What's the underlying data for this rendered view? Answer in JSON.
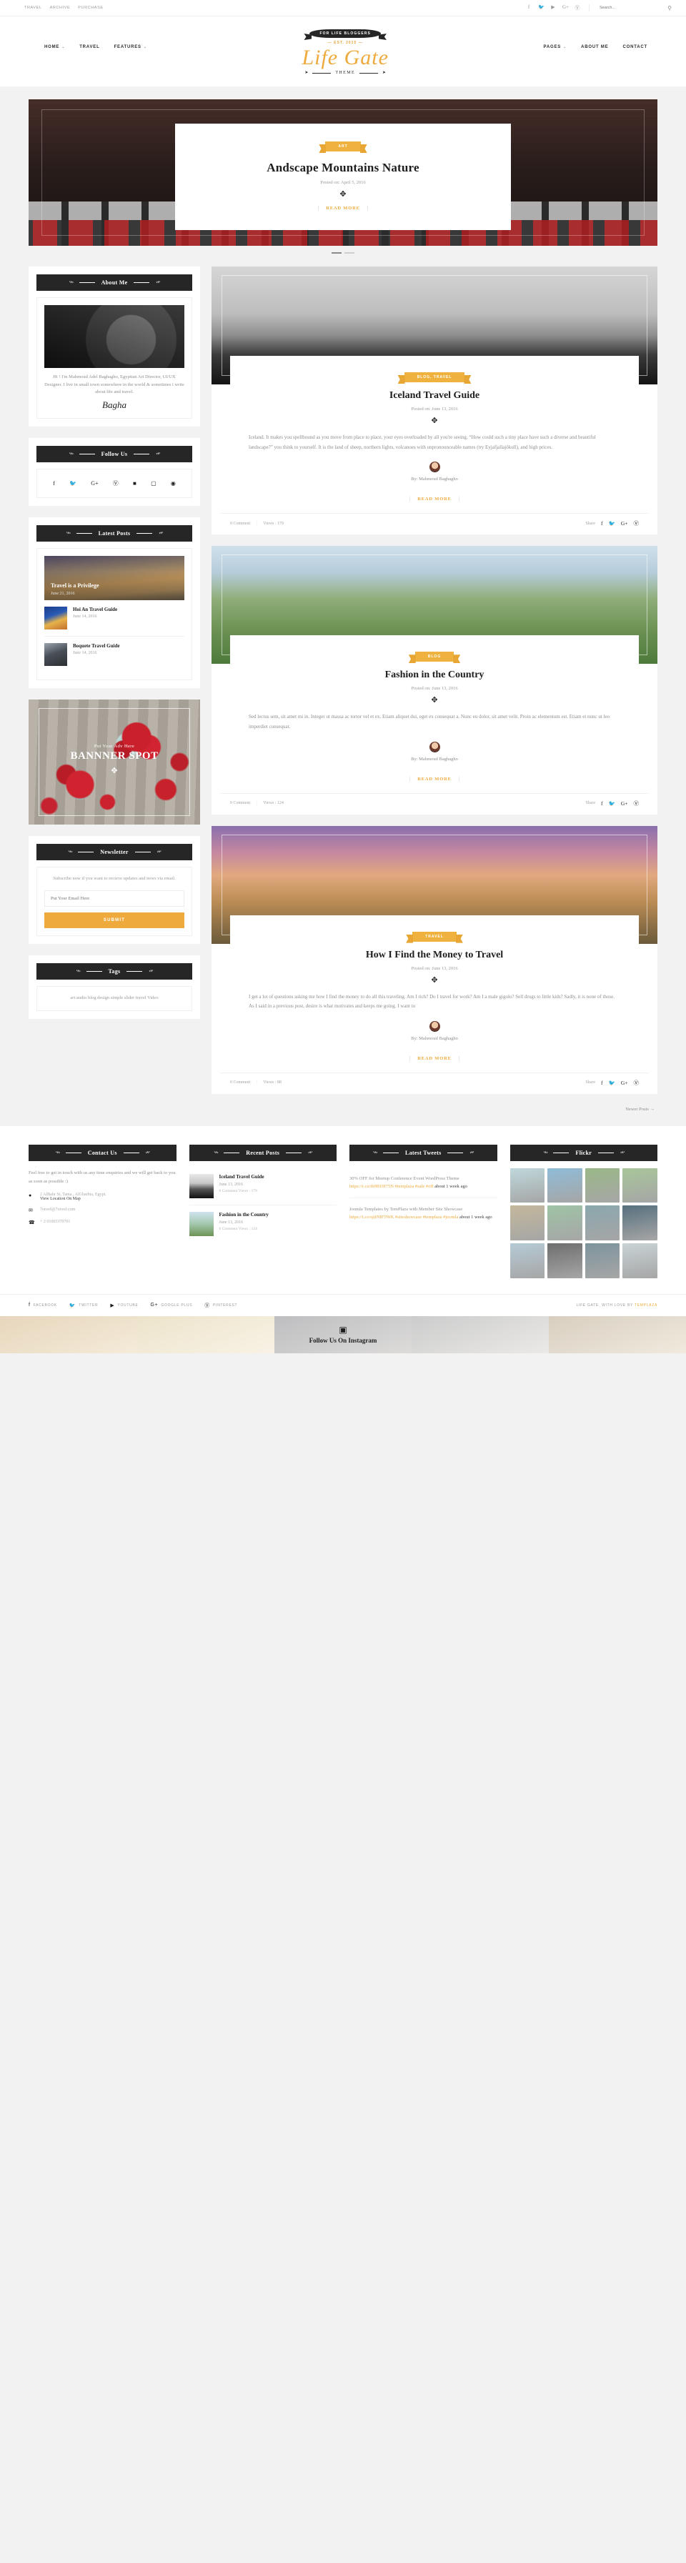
{
  "topbar": {
    "links": [
      "TRAVEL",
      "ARCHIVE",
      "PURCHASE"
    ],
    "social": [
      "facebook-icon",
      "twitter-icon",
      "youtube-icon",
      "google-plus-icon",
      "pinterest-icon"
    ],
    "search_placeholder": "Search...",
    "search_value": ""
  },
  "header": {
    "nav_left": [
      {
        "label": "HOME",
        "caret": "˅"
      },
      {
        "label": "TRAVEL",
        "caret": ""
      },
      {
        "label": "FEATURES",
        "caret": "˅"
      }
    ],
    "nav_right": [
      {
        "label": "PAGES",
        "caret": "˅"
      },
      {
        "label": "ABOUT ME",
        "caret": ""
      },
      {
        "label": "CONTACT",
        "caret": ""
      }
    ],
    "ribbon": "FOR LIFE BLOGGERS",
    "est": "EST. 2015",
    "logo": "Life Gate",
    "theme": "THEME"
  },
  "slider": {
    "category": "ART",
    "title": "Andscape Mountains Nature",
    "posted_label": "Posted on:",
    "date": "April 5, 2016",
    "read_more": "READ MORE",
    "dots": 2,
    "active_dot": 0
  },
  "sidebar": {
    "about": {
      "title": "About Me",
      "bio": "Hi ! I'm Mahmoud Adel Baghagho, Egyptian Art Director, UI/UX Designer. I live in small town somewhere in the world & sometimes i write about life and travel.",
      "signature": "Bagha"
    },
    "follow": {
      "title": "Follow Us",
      "icons": [
        "facebook-icon",
        "twitter-icon",
        "google-plus-icon",
        "pinterest-icon",
        "vimeo-icon",
        "instagram-icon",
        "rss-icon"
      ]
    },
    "latest": {
      "title": "Latest Posts",
      "featured": {
        "title": "Travel is a Privilege",
        "date": "June 21, 2016"
      },
      "items": [
        {
          "title": "Hoi An Travel Guide",
          "date": "June 14, 2016"
        },
        {
          "title": "Boquete Travel Guide",
          "date": "June 14, 2016"
        }
      ]
    },
    "banner": {
      "small": "Put Your Adv Here",
      "big": "BANNNER SPOT"
    },
    "newsletter": {
      "title": "Newsletter",
      "text": "Subscribe now if you want to recieve updates and news via email.",
      "placeholder": "Put Your Email Here",
      "value": "",
      "submit": "SUBMIT"
    },
    "tags": {
      "title": "Tags",
      "items": "art audio blog design simple slider travel Video"
    }
  },
  "posts": [
    {
      "category": "BLOG, TRAVEL",
      "title": "Iceland Travel Guide",
      "posted_label": "Posted on:",
      "date": "June 13, 2016",
      "excerpt": "Iceland. It makes you spellbound as you move from place to place, your eyes overloaded by all you're seeing. “How could such a tiny place have such a diverse and beautiful landscape?” you think to yourself. It is the land of sheep, northern lights, volcanoes with unpronounceable names (try Eyjafjallajökull), and high prices.",
      "by": "By: Mahmoud Baghagho",
      "read_more": "READ MORE",
      "comments": "0  Comment",
      "views": "Views : 179",
      "share_label": "Share"
    },
    {
      "category": "BLOG",
      "title": "Fashion in the Country",
      "posted_label": "Posted on:",
      "date": "June 13, 2016",
      "excerpt": "Sed lectus sem, sit amet mi in. Integer ut massa ac tortor vel et ex. Etiam aliquet dui, eget ex consequat a. Nunc eu dolor, sit amet velit. Proin ac elementum est. Etiam et nunc ut leo imperdiet consequat.",
      "by": "By: Mahmoud Baghagho",
      "read_more": "READ MORE",
      "comments": "0  Comment",
      "views": "Views : 124",
      "share_label": "Share"
    },
    {
      "category": "TRAVEL",
      "title": "How I Find the Money to Travel",
      "posted_label": "Posted on:",
      "date": "June 13, 2016",
      "excerpt": "I get a lot of questions asking me how I find the money to do all this traveling. Am I rich? Do I travel for work? Am I a male gigolo? Sell drugs to little kids? Sadly, it is none of those. As I said in a previous post, desire is what motivates and keeps me going. I want to",
      "by": "By: Mahmoud Baghagho",
      "read_more": "READ MORE",
      "comments": "0  Comment",
      "views": "Views : 88",
      "share_label": "Share"
    }
  ],
  "pager": {
    "newer": "Newer Posts →"
  },
  "footer": {
    "contact": {
      "title": "Contact Us",
      "text": "Feel free to get in touch with us any time enquiries and we will get back to you as soon as possible :)",
      "address": "2 AlBahr St, Tanta , AlGharbia, Egypt.",
      "map_link": "View Location On Map",
      "email": "7oroof@7oroof.com",
      "phone": "+ 2 01065370701"
    },
    "recent": {
      "title": "Recent Posts",
      "items": [
        {
          "title": "Iceland Travel Guide",
          "date": "June 13, 2016",
          "meta": "0 Comment   Views : 179"
        },
        {
          "title": "Fashion in the Country",
          "date": "June 13, 2016",
          "meta": "0 Comment   Views : 124"
        }
      ]
    },
    "tweets": {
      "title": "Latest Tweets",
      "items": [
        {
          "text": "30% OFF for Meetup Conference Event WordPress Theme ",
          "link": "https://t.co/ih9B10I75N #templaza #sale #off",
          "ago": "about 1 week ago"
        },
        {
          "text": "Joomla Templates by TemPlaza with Member Site Showcase ",
          "link": "https://t.co/sjiINIF5WK #siteshowcase #templaza #joomla",
          "ago": "about 1 week ago"
        }
      ]
    },
    "flickr": {
      "title": "Flickr",
      "colors": [
        "#bfd8dc",
        "#8fbcd8",
        "#9ab887",
        "#a8c69a",
        "#c4b89c",
        "#9fc4a6",
        "#8aa7ae",
        "#56707e",
        "#b6cbd6",
        "#6e6e6e",
        "#7d949d",
        "#c9d4d6"
      ]
    },
    "bottom": {
      "social": [
        {
          "label": "FACEBOOK",
          "icon": "facebook-icon"
        },
        {
          "label": "TWITTER",
          "icon": "twitter-icon"
        },
        {
          "label": "YOUTUBE",
          "icon": "youtube-icon"
        },
        {
          "label": "GOOGLE PLUS",
          "icon": "google-plus-icon"
        },
        {
          "label": "PINTEREST",
          "icon": "pinterest-icon"
        }
      ],
      "credit_prefix": "LIFE GATE, WITH LOVE BY ",
      "credit_brand": "TEMPLAZA"
    },
    "instagram": {
      "icon": "instagram-icon",
      "title": "Follow Us On Instagram"
    }
  },
  "colors": {
    "accent": "#eeaa3c",
    "dark": "#262626",
    "muted": "#8d8d8d",
    "page_bg": "#f2f2f2"
  }
}
